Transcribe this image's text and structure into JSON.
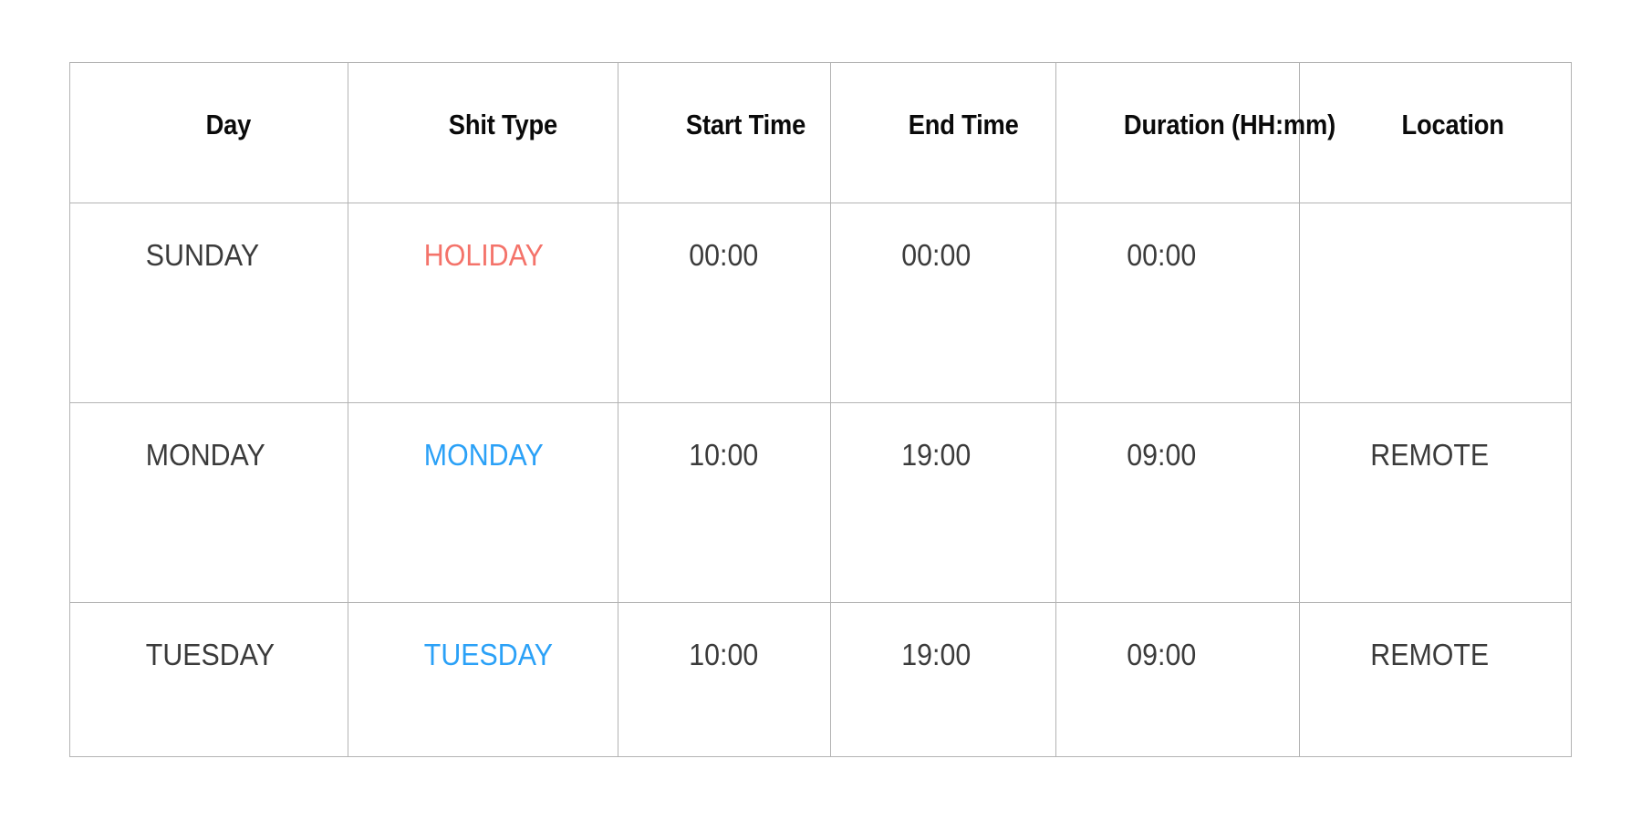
{
  "table": {
    "columns": [
      {
        "key": "day",
        "label": "Day"
      },
      {
        "key": "type",
        "label": "Shit Type"
      },
      {
        "key": "start",
        "label": "Start Time"
      },
      {
        "key": "end",
        "label": "End Time"
      },
      {
        "key": "duration",
        "label": "Duration (HH:mm)"
      },
      {
        "key": "location",
        "label": "Location"
      }
    ],
    "rows": [
      {
        "day": "SUNDAY",
        "type": "HOLIDAY",
        "type_style": "holiday",
        "start": "00:00",
        "end": "00:00",
        "duration": "00:00",
        "location": ""
      },
      {
        "day": "MONDAY",
        "type": "MONDAY",
        "type_style": "shift",
        "start": "10:00",
        "end": "19:00",
        "duration": "09:00",
        "location": "REMOTE"
      },
      {
        "day": "TUESDAY",
        "type": "TUESDAY",
        "type_style": "shift",
        "start": "10:00",
        "end": "19:00",
        "duration": "09:00",
        "location": "REMOTE"
      }
    ]
  },
  "colors": {
    "holiday_text": "#f4736a",
    "shift_text": "#2ba1f7",
    "body_text": "#3b3b3b",
    "header_text": "#0a0a0a",
    "border": "#b3b3b3",
    "background": "#ffffff"
  }
}
